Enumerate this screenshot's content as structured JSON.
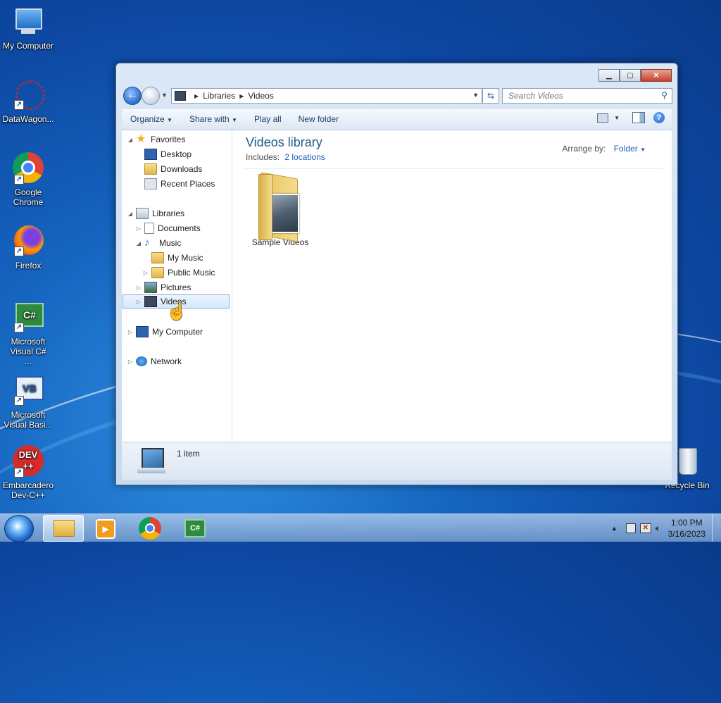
{
  "desktop": {
    "icons": [
      {
        "label": "My Computer"
      },
      {
        "label": "DataWagon..."
      },
      {
        "label": "Google Chrome"
      },
      {
        "label": "Firefox"
      },
      {
        "label": "Microsoft Visual C# ..."
      },
      {
        "label": "Microsoft Visual Basi..."
      },
      {
        "label": "Embarcadero Dev-C++"
      },
      {
        "label": "Recycle Bin"
      }
    ]
  },
  "window": {
    "address": {
      "crumbs": [
        "Libraries",
        "Videos"
      ]
    },
    "search": {
      "placeholder": "Search Videos"
    },
    "toolbar": {
      "organize": "Organize",
      "share_with": "Share with",
      "play_all": "Play all",
      "new_folder": "New folder"
    },
    "nav": {
      "favorites": "Favorites",
      "desktop": "Desktop",
      "downloads": "Downloads",
      "recent_places": "Recent Places",
      "libraries": "Libraries",
      "documents": "Documents",
      "music": "Music",
      "my_music": "My Music",
      "public_music": "Public Music",
      "pictures": "Pictures",
      "videos": "Videos",
      "my_computer": "My Computer",
      "network": "Network"
    },
    "content": {
      "title": "Videos library",
      "includes_label": "Includes:",
      "includes_link": "2 locations",
      "arrange_label": "Arrange by:",
      "arrange_value": "Folder",
      "items": [
        {
          "label": "Sample Videos"
        }
      ]
    },
    "status": {
      "text": "1 item"
    }
  },
  "taskbar": {
    "time": "1:00 PM",
    "date": "3/16/2023"
  }
}
